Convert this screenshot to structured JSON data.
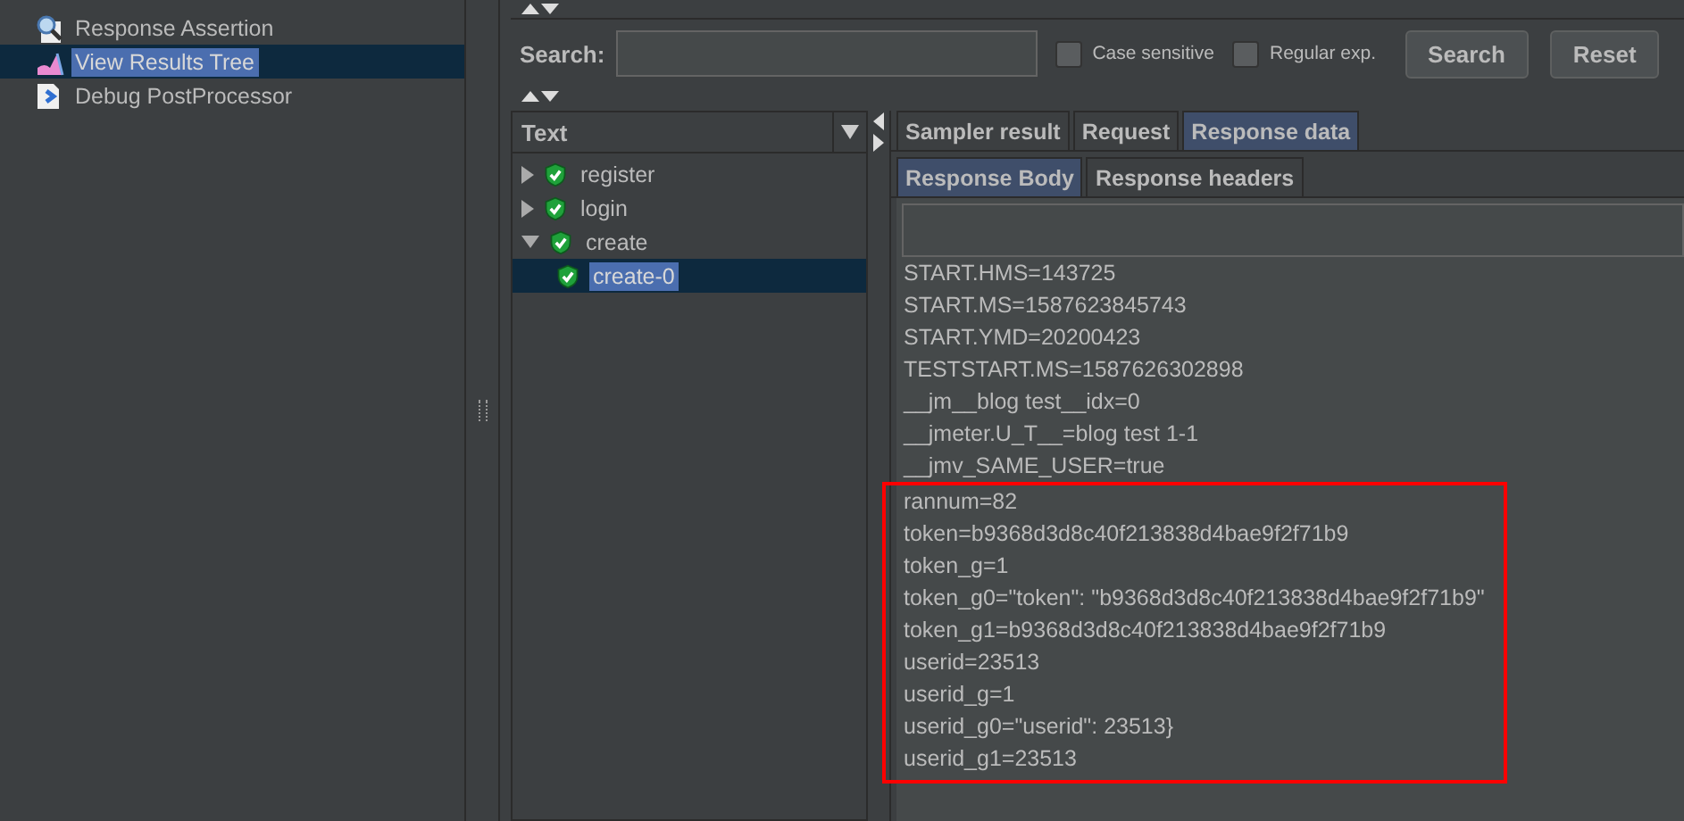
{
  "test_plan_tree": {
    "items": [
      {
        "label": "Response Assertion",
        "selected": false
      },
      {
        "label": "View Results Tree",
        "selected": true
      },
      {
        "label": "Debug PostProcessor",
        "selected": false
      }
    ]
  },
  "search_bar": {
    "label": "Search:",
    "options": [
      {
        "label": "Case sensitive",
        "checked": false
      },
      {
        "label": "Regular exp.",
        "checked": false
      }
    ],
    "buttons": [
      "Search",
      "Reset"
    ]
  },
  "renderer": {
    "value": "Text"
  },
  "results": [
    {
      "label": "register",
      "expanded": false,
      "selected": false
    },
    {
      "label": "login",
      "expanded": false,
      "selected": false
    },
    {
      "label": "create",
      "expanded": true,
      "selected": false,
      "children": [
        {
          "label": "create-0",
          "selected": true
        }
      ]
    }
  ],
  "tabs": [
    {
      "label": "Sampler result",
      "selected": false
    },
    {
      "label": "Request",
      "selected": false
    },
    {
      "label": "Response data",
      "selected": true
    }
  ],
  "subtabs": [
    {
      "label": "Response Body",
      "selected": true
    },
    {
      "label": "Response headers",
      "selected": false
    }
  ],
  "body_lines": [
    {
      "text": "START.HMS=143725",
      "highlighted": false
    },
    {
      "text": "START.MS=1587623845743",
      "highlighted": false
    },
    {
      "text": "START.YMD=20200423",
      "highlighted": false
    },
    {
      "text": "TESTSTART.MS=1587626302898",
      "highlighted": false
    },
    {
      "text": "__jm__blog test__idx=0",
      "highlighted": false
    },
    {
      "text": "__jmeter.U_T__=blog test 1-1",
      "highlighted": false
    },
    {
      "text": "__jmv_SAME_USER=true",
      "highlighted": false
    },
    {
      "text": "rannum=82",
      "highlighted": true
    },
    {
      "text": "token=b9368d3d8c40f213838d4bae9f2f71b9",
      "highlighted": true
    },
    {
      "text": "token_g=1",
      "highlighted": true
    },
    {
      "text": "token_g0=\"token\": \"b9368d3d8c40f213838d4bae9f2f71b9\"",
      "highlighted": true
    },
    {
      "text": "token_g1=b9368d3d8c40f213838d4bae9f2f71b9",
      "highlighted": true
    },
    {
      "text": "userid=23513",
      "highlighted": true
    },
    {
      "text": "userid_g=1",
      "highlighted": true
    },
    {
      "text": "userid_g0=\"userid\": 23513}",
      "highlighted": true
    },
    {
      "text": "userid_g1=23513",
      "highlighted": true
    }
  ]
}
